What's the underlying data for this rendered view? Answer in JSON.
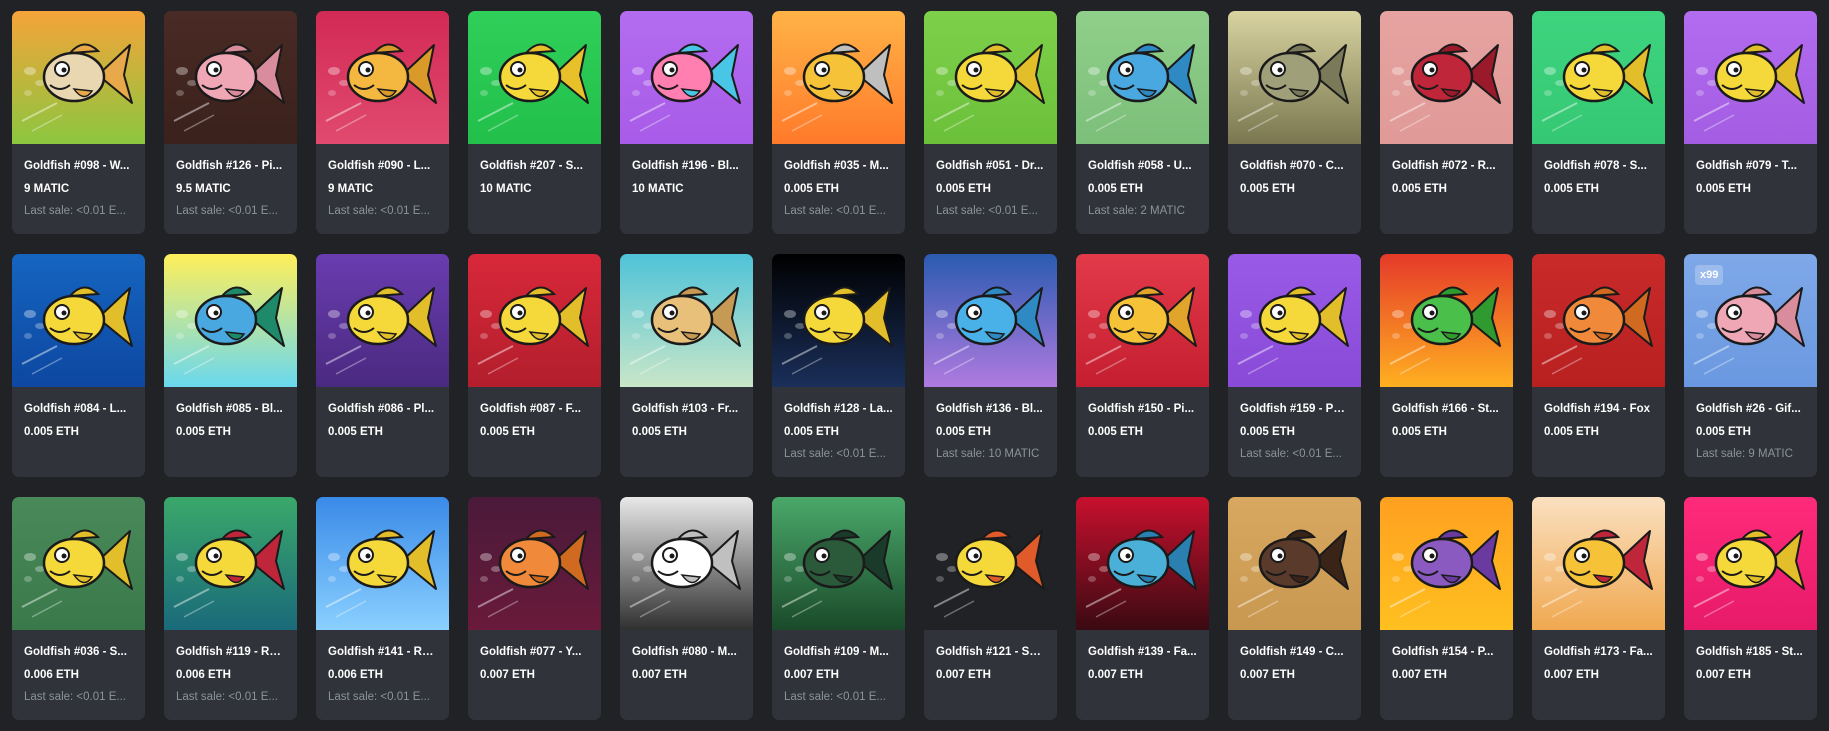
{
  "cards": [
    {
      "title": "Goldfish #098 - W...",
      "price": "9 MATIC",
      "last_sale": "Last sale: <0.01 E...",
      "bg": [
        "#f5a43a",
        "#8cc63f"
      ],
      "body": "#e8d7b0",
      "fin": "#e8a94a"
    },
    {
      "title": "Goldfish #126 - Pi...",
      "price": "9.5 MATIC",
      "last_sale": "Last sale: <0.01 E...",
      "bg": [
        "#4a2a24",
        "#3a211c"
      ],
      "body": "#f0a7b5",
      "fin": "#d98c9c"
    },
    {
      "title": "Goldfish #090 - L...",
      "price": "9 MATIC",
      "last_sale": "Last sale: <0.01 E...",
      "bg": [
        "#d22a55",
        "#e14a6e"
      ],
      "body": "#f4b840",
      "fin": "#d99a2a"
    },
    {
      "title": "Goldfish #207 - S...",
      "price": "10 MATIC",
      "last_sale": "",
      "bg": [
        "#2fcf5a",
        "#22c04a"
      ],
      "body": "#f5d93a",
      "fin": "#e8c12a"
    },
    {
      "title": "Goldfish #196 - Bl...",
      "price": "10 MATIC",
      "last_sale": "",
      "bg": [
        "#b36cf0",
        "#a85be8"
      ],
      "body": "#ff7fb0",
      "fin": "#49c6e5"
    },
    {
      "title": "Goldfish #035 - M...",
      "price": "0.005 ETH",
      "last_sale": "Last sale: <0.01 E...",
      "bg": [
        "#ffb347",
        "#ff7a2a"
      ],
      "body": "#f5c238",
      "fin": "#bfbfbf"
    },
    {
      "title": "Goldfish #051 - Dr...",
      "price": "0.005 ETH",
      "last_sale": "Last sale: <0.01 E...",
      "bg": [
        "#7ed04a",
        "#6bc03a"
      ],
      "body": "#f5d93a",
      "fin": "#e3be2b"
    },
    {
      "title": "Goldfish #058 - U...",
      "price": "0.005 ETH",
      "last_sale": "Last sale: 2 MATIC",
      "bg": [
        "#8fcf8a",
        "#7cbf7a"
      ],
      "body": "#4aa8e0",
      "fin": "#2f8ac4"
    },
    {
      "title": "Goldfish #070 - C...",
      "price": "0.005 ETH",
      "last_sale": "",
      "bg": [
        "#d8d3a0",
        "#7a7750"
      ],
      "body": "#9fa07a",
      "fin": "#7a7a5a"
    },
    {
      "title": "Goldfish #072 - R...",
      "price": "0.005 ETH",
      "last_sale": "",
      "bg": [
        "#e6a3a0",
        "#e09a98"
      ],
      "body": "#c0263a",
      "fin": "#9a1a2c"
    },
    {
      "title": "Goldfish #078 - S...",
      "price": "0.005 ETH",
      "last_sale": "",
      "bg": [
        "#3ed47e",
        "#35c874"
      ],
      "body": "#f5d93a",
      "fin": "#e3be2b"
    },
    {
      "title": "Goldfish #079 - T...",
      "price": "0.005 ETH",
      "last_sale": "",
      "bg": [
        "#b36cf0",
        "#a35de2"
      ],
      "body": "#f5d93a",
      "fin": "#e3be2b"
    },
    {
      "title": "Goldfish #084 - L...",
      "price": "0.005 ETH",
      "last_sale": "",
      "bg": [
        "#1565c0",
        "#0d47a1"
      ],
      "body": "#f5d93a",
      "fin": "#e3be2b"
    },
    {
      "title": "Goldfish #085 - Bl...",
      "price": "0.005 ETH",
      "last_sale": "",
      "bg": [
        "#ffef5a",
        "#6ad8ef"
      ],
      "body": "#4aa8e0",
      "fin": "#1f8a6a"
    },
    {
      "title": "Goldfish #086 - Pl...",
      "price": "0.005 ETH",
      "last_sale": "",
      "bg": [
        "#6a3cb0",
        "#4a2a80"
      ],
      "body": "#f5d93a",
      "fin": "#e3be2b"
    },
    {
      "title": "Goldfish #087 - F...",
      "price": "0.005 ETH",
      "last_sale": "",
      "bg": [
        "#d8283a",
        "#b31e2c"
      ],
      "body": "#f5d93a",
      "fin": "#e3be2b"
    },
    {
      "title": "Goldfish #103 - Fr...",
      "price": "0.005 ETH",
      "last_sale": "",
      "bg": [
        "#4fc3d8",
        "#c9e6c8"
      ],
      "body": "#e8c07a",
      "fin": "#c69a55"
    },
    {
      "title": "Goldfish #128 - La...",
      "price": "0.005 ETH",
      "last_sale": "Last sale: <0.01 E...",
      "bg": [
        "#000000",
        "#1a2f5a"
      ],
      "body": "#f5d93a",
      "fin": "#e3be2b"
    },
    {
      "title": "Goldfish #136 - Bl...",
      "price": "0.005 ETH",
      "last_sale": "Last sale: 10 MATIC",
      "bg": [
        "#2a5bb0",
        "#b07ae0"
      ],
      "body": "#4ab0e8",
      "fin": "#2f8ac4"
    },
    {
      "title": "Goldfish #150 - Pi...",
      "price": "0.005 ETH",
      "last_sale": "",
      "bg": [
        "#e33a4a",
        "#c41e30"
      ],
      "body": "#f5c238",
      "fin": "#e0a52a"
    },
    {
      "title": "Goldfish #159 - Po...",
      "price": "0.005 ETH",
      "last_sale": "Last sale: <0.01 E...",
      "bg": [
        "#9a5ae8",
        "#8a4ad8"
      ],
      "body": "#f5d93a",
      "fin": "#e3be2b"
    },
    {
      "title": "Goldfish #166 - St...",
      "price": "0.005 ETH",
      "last_sale": "",
      "bg": [
        "#e53a2a",
        "#ffb020"
      ],
      "body": "#4ac04a",
      "fin": "#2f9a2f"
    },
    {
      "title": "Goldfish #194 - Fox",
      "price": "0.005 ETH",
      "last_sale": "",
      "bg": [
        "#c92a2a",
        "#b82020"
      ],
      "body": "#f08a3a",
      "fin": "#d06a20"
    },
    {
      "title": "Goldfish #26 - Gif...",
      "price": "0.005 ETH",
      "last_sale": "Last sale: 9 MATIC",
      "bg": [
        "#7ea8e8",
        "#6a98e0"
      ],
      "body": "#f0a7b5",
      "fin": "#d98c9c",
      "badge": "x99"
    },
    {
      "title": "Goldfish #036 - S...",
      "price": "0.006 ETH",
      "last_sale": "Last sale: <0.01 E...",
      "bg": [
        "#4a8a5a",
        "#3a7a4a"
      ],
      "body": "#f5d93a",
      "fin": "#e3be2b"
    },
    {
      "title": "Goldfish #119 - Ro...",
      "price": "0.006 ETH",
      "last_sale": "Last sale: <0.01 E...",
      "bg": [
        "#3aa86a",
        "#1a6a7a"
      ],
      "body": "#f5d93a",
      "fin": "#c0263a"
    },
    {
      "title": "Goldfish #141 - Ra...",
      "price": "0.006 ETH",
      "last_sale": "Last sale: <0.01 E...",
      "bg": [
        "#3a8ae8",
        "#8ad0ff"
      ],
      "body": "#f5d93a",
      "fin": "#e3be2b"
    },
    {
      "title": "Goldfish #077 - Y...",
      "price": "0.007 ETH",
      "last_sale": "",
      "bg": [
        "#4a1a3a",
        "#6a1a3a"
      ],
      "body": "#f08a3a",
      "fin": "#d06a20"
    },
    {
      "title": "Goldfish #080 - M...",
      "price": "0.007 ETH",
      "last_sale": "",
      "bg": [
        "#e8e8e8",
        "#303030"
      ],
      "body": "#ffffff",
      "fin": "#c0c0c0"
    },
    {
      "title": "Goldfish #109 - M...",
      "price": "0.007 ETH",
      "last_sale": "Last sale: <0.01 E...",
      "bg": [
        "#4aa86a",
        "#1a4a2a"
      ],
      "body": "#2a5a3a",
      "fin": "#1a3a2a"
    },
    {
      "title": "Goldfish #121 - Sh...",
      "price": "0.007 ETH",
      "last_sale": "",
      "bg": [
        "#202225",
        "#202225"
      ],
      "body": "#f5d93a",
      "fin": "#e05a2a"
    },
    {
      "title": "Goldfish #139 - Fa...",
      "price": "0.007 ETH",
      "last_sale": "",
      "bg": [
        "#c8102e",
        "#3a0a12"
      ],
      "body": "#4ab0d8",
      "fin": "#2a80b0"
    },
    {
      "title": "Goldfish #149 - C...",
      "price": "0.007 ETH",
      "last_sale": "",
      "bg": [
        "#d8a860",
        "#c89850"
      ],
      "body": "#5a3a2a",
      "fin": "#3a2418"
    },
    {
      "title": "Goldfish #154 - P...",
      "price": "0.007 ETH",
      "last_sale": "",
      "bg": [
        "#ffa020",
        "#ffc020"
      ],
      "body": "#8a5ac0",
      "fin": "#6a3aa0"
    },
    {
      "title": "Goldfish #173 - Fa...",
      "price": "0.007 ETH",
      "last_sale": "",
      "bg": [
        "#fae0c0",
        "#f0a850"
      ],
      "body": "#f5c238",
      "fin": "#c0263a"
    },
    {
      "title": "Goldfish #185 - St...",
      "price": "0.007 ETH",
      "last_sale": "",
      "bg": [
        "#ff2a7a",
        "#e81a6a"
      ],
      "body": "#f5d93a",
      "fin": "#e3be2b"
    }
  ]
}
